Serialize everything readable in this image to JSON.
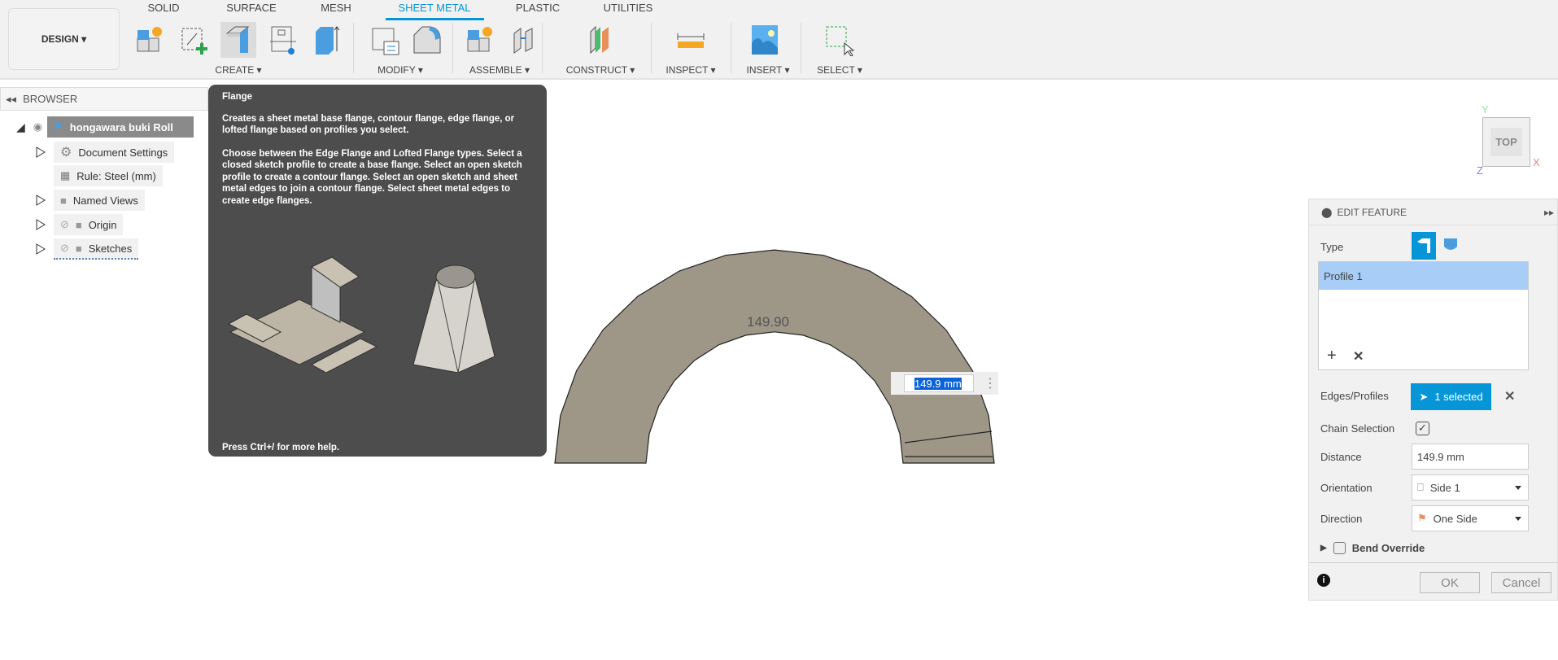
{
  "toolbar": {
    "workspace": "DESIGN",
    "tabs": [
      "SOLID",
      "SURFACE",
      "MESH",
      "SHEET METAL",
      "PLASTIC",
      "UTILITIES"
    ],
    "active_tab": "SHEET METAL",
    "groups": [
      "CREATE",
      "MODIFY",
      "ASSEMBLE",
      "CONSTRUCT",
      "INSPECT",
      "INSERT",
      "SELECT"
    ]
  },
  "browser": {
    "title": "BROWSER",
    "root": "hongawara buki Roll",
    "items": [
      "Document Settings",
      "Rule: Steel (mm)",
      "Named Views",
      "Origin",
      "Sketches"
    ]
  },
  "tooltip": {
    "title": "Flange",
    "p1": "Creates a sheet metal base flange, contour flange, edge flange, or lofted flange based on profiles you select.",
    "p2": "Choose between the Edge Flange and Lofted Flange types. Select a closed sketch profile to create a base flange. Select an open sketch profile to create a contour flange. Select an open sketch and sheet metal edges to join a contour flange. Select sheet metal edges to create edge flanges.",
    "footer": "Press Ctrl+/ for more help."
  },
  "viewport": {
    "dimension_label": "149.90",
    "dimension_input": "149.9 mm",
    "viewcube": "TOP",
    "axes": {
      "x": "X",
      "y": "Y",
      "z": "Z"
    },
    "part_color": "#9e9788"
  },
  "panel": {
    "title": "EDIT FEATURE",
    "type_label": "Type",
    "profile": "Profile 1",
    "edges_label": "Edges/Profiles",
    "edges_value": "1 selected",
    "chain_label": "Chain Selection",
    "chain_checked": true,
    "distance_label": "Distance",
    "distance_value": "149.9 mm",
    "orientation_label": "Orientation",
    "orientation_value": "Side 1",
    "direction_label": "Direction",
    "direction_value": "One Side",
    "bend_label": "Bend Override",
    "bend_checked": false,
    "ok": "OK",
    "cancel": "Cancel",
    "accent": "#0696d7"
  }
}
